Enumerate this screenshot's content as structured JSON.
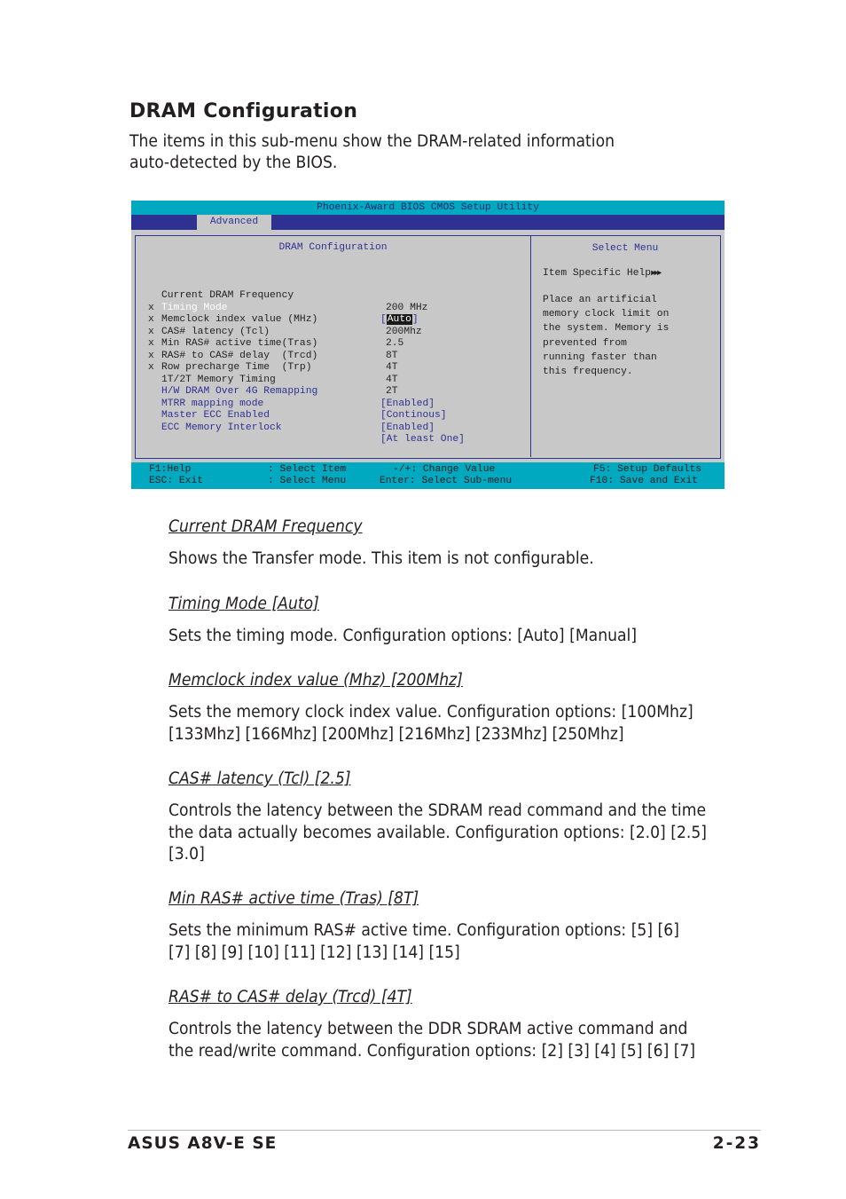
{
  "section": {
    "title": "DRAM Configuration",
    "intro": "The items in this sub-menu show the DRAM-related information auto-detected by the BIOS."
  },
  "bios": {
    "title": "Phoenix-Award BIOS CMOS Setup Utility",
    "tab": "Advanced",
    "panel_title": "DRAM Configuration",
    "help_panel_title": "Select Menu",
    "colors": {
      "title_bar": "#00a8c0",
      "menu_bar": "#2e3192",
      "panel_bg": "#c8c8c8",
      "accent_text": "#2e3192",
      "highlight_text": "#ffffff"
    },
    "items": [
      {
        "mark": "",
        "label": "Current DRAM Frequency",
        "value": "200 MHz",
        "style": "normal"
      },
      {
        "mark": "",
        "label": "Timing Mode",
        "value": "Auto",
        "style": "highlight",
        "bracketed": true,
        "selected": true
      },
      {
        "mark": "x",
        "label": "Memclock index value (MHz)",
        "value": "200Mhz",
        "style": "normal"
      },
      {
        "mark": "x",
        "label": "CAS# latency (Tcl)",
        "value": "2.5",
        "style": "normal"
      },
      {
        "mark": "x",
        "label": "Min RAS# active time(Tras)",
        "value": "8T",
        "style": "normal"
      },
      {
        "mark": "x",
        "label": "RAS# to CAS# delay  (Trcd)",
        "value": "4T",
        "style": "normal"
      },
      {
        "mark": "x",
        "label": "Row precharge Time  (Trp)",
        "value": "4T",
        "style": "normal"
      },
      {
        "mark": "x",
        "label": "1T/2T Memory Timing",
        "value": "2T",
        "style": "normal"
      },
      {
        "mark": "",
        "label": "H/W DRAM Over 4G Remapping",
        "value": "[Enabled]",
        "style": "blue"
      },
      {
        "mark": "",
        "label": "MTRR mapping mode",
        "value": "[Continous]",
        "style": "blue"
      },
      {
        "mark": "",
        "label": "Master ECC Enabled",
        "value": "[Enabled]",
        "style": "blue"
      },
      {
        "mark": "",
        "label": "ECC Memory Interlock",
        "value": "[At least One]",
        "style": "blue"
      }
    ],
    "help": {
      "title": "Item Specific Help",
      "arrows": "►►►",
      "text": "Place an artificial\nmemory clock limit on\nthe system. Memory is\nprevented from\nrunning faster than\nthis frequency."
    },
    "footer": {
      "f1": "F1:Help",
      "esc": "ESC: Exit",
      "select_item": ": Select Item",
      "select_menu": ": Select Menu",
      "change_value": "-/+: Change Value",
      "select_submenu": "Enter: Select Sub-menu",
      "setup_defaults": "F5: Setup Defaults",
      "save_exit": "F10: Save and Exit"
    }
  },
  "descriptions": [
    {
      "title": "Current DRAM Frequency",
      "text": "Shows the Transfer mode. This item is not configurable."
    },
    {
      "title": "Timing Mode [Auto]",
      "text": "Sets the timing mode. Configuration options: [Auto] [Manual]"
    },
    {
      "title": "Memclock index value (Mhz) [200Mhz]",
      "text": "Sets the memory clock index value. Configuration options: [100Mhz] [133Mhz] [166Mhz] [200Mhz] [216Mhz] [233Mhz] [250Mhz]"
    },
    {
      "title": "CAS# latency (Tcl) [2.5]",
      "text": "Controls the latency between the SDRAM read command and the time the data actually becomes available. Configuration options: [2.0] [2.5] [3.0]"
    },
    {
      "title": "Min RAS# active time (Tras) [8T]",
      "text": "Sets the minimum RAS# active time. Configuration options: [5] [6] [7] [8] [9] [10] [11] [12] [13] [14] [15]"
    },
    {
      "title": "RAS# to CAS# delay (Trcd) [4T]",
      "text": "Controls the latency between the DDR SDRAM active command and the read/write command. Configuration options: [2] [3] [4] [5] [6] [7]"
    }
  ],
  "page_footer": {
    "product": "ASUS A8V-E SE",
    "page_number": "2-23"
  }
}
